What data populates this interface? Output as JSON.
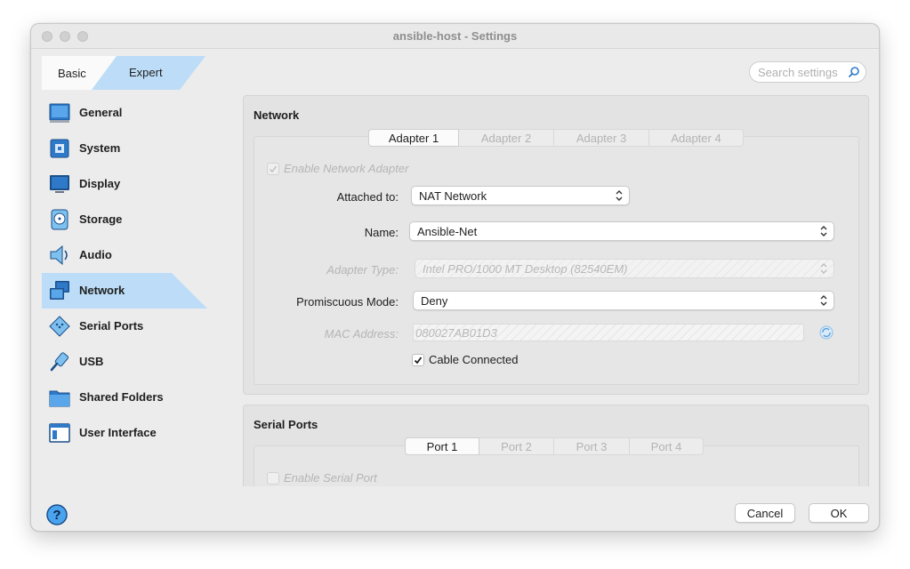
{
  "window": {
    "title": "ansible-host - Settings"
  },
  "mode": {
    "basic_label": "Basic",
    "expert_label": "Expert",
    "selected": "Expert"
  },
  "search": {
    "placeholder": "Search settings"
  },
  "sidebar": {
    "selected": "Network",
    "items": [
      {
        "label": "General",
        "icon": "general-icon"
      },
      {
        "label": "System",
        "icon": "system-icon"
      },
      {
        "label": "Display",
        "icon": "display-icon"
      },
      {
        "label": "Storage",
        "icon": "storage-icon"
      },
      {
        "label": "Audio",
        "icon": "audio-icon"
      },
      {
        "label": "Network",
        "icon": "network-icon"
      },
      {
        "label": "Serial Ports",
        "icon": "serial-ports-icon"
      },
      {
        "label": "USB",
        "icon": "usb-icon"
      },
      {
        "label": "Shared Folders",
        "icon": "shared-folders-icon"
      },
      {
        "label": "User Interface",
        "icon": "user-interface-icon"
      }
    ]
  },
  "network": {
    "title": "Network",
    "tabs": [
      "Adapter 1",
      "Adapter 2",
      "Adapter 3",
      "Adapter 4"
    ],
    "active_tab": "Adapter 1",
    "enable_label": "Enable Network Adapter",
    "enable_checked": true,
    "attached_to": {
      "label": "Attached to:",
      "value": "NAT Network"
    },
    "name": {
      "label": "Name:",
      "value": "Ansible-Net"
    },
    "adapter_type": {
      "label": "Adapter Type:",
      "value": "Intel PRO/1000 MT Desktop (82540EM)"
    },
    "promiscuous": {
      "label": "Promiscuous Mode:",
      "value": "Deny"
    },
    "mac": {
      "label": "MAC Address:",
      "value": "080027AB01D3"
    },
    "cable_connected": {
      "label": "Cable Connected",
      "checked": true
    }
  },
  "serial": {
    "title": "Serial Ports",
    "tabs": [
      "Port 1",
      "Port 2",
      "Port 3",
      "Port 4"
    ],
    "active_tab": "Port 1",
    "enable_label": "Enable Serial Port"
  },
  "buttons": {
    "cancel": "Cancel",
    "ok": "OK"
  },
  "colors": {
    "accent": "#bcdcf7",
    "selection_border": "#9cc6ee",
    "icon_blue": "#2e7ac9"
  }
}
